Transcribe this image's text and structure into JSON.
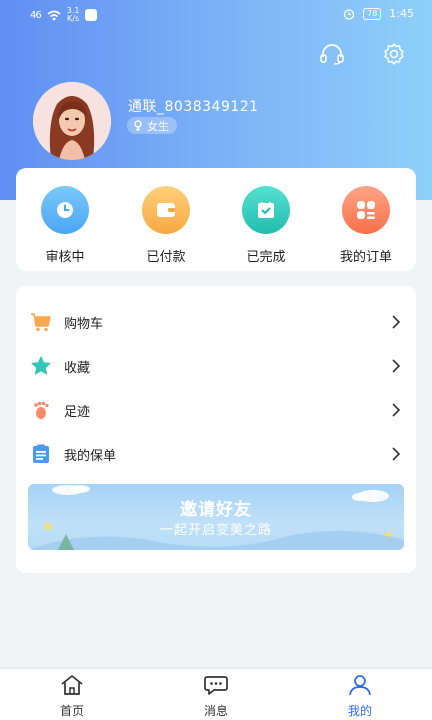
{
  "status_bar": {
    "signal": "46",
    "speed_top": "3.1",
    "speed_bottom": "K/s",
    "battery": "78",
    "time": "1:45"
  },
  "header": {
    "icons": [
      "headset-icon",
      "gear-icon"
    ]
  },
  "profile": {
    "username": "通联_8038349121",
    "gender": "女生"
  },
  "orders": [
    {
      "label": "审核中",
      "icon": "clock-icon",
      "color": "#56b3f5"
    },
    {
      "label": "已付款",
      "icon": "wallet-icon",
      "color": "#f8b552"
    },
    {
      "label": "已完成",
      "icon": "check-bag-icon",
      "color": "#33cbbd"
    },
    {
      "label": "我的订单",
      "icon": "orders-grid-icon",
      "color": "#fa8560"
    }
  ],
  "menu": [
    {
      "label": "购物车",
      "icon": "cart-icon",
      "color": "#f6a94f"
    },
    {
      "label": "收藏",
      "icon": "star-icon",
      "color": "#31c6b8"
    },
    {
      "label": "足迹",
      "icon": "footprint-icon",
      "color": "#f98969"
    },
    {
      "label": "我的保单",
      "icon": "policy-icon",
      "color": "#4a9cf2"
    }
  ],
  "banner": {
    "title": "邀请好友",
    "subtitle": "一起开启变美之路"
  },
  "tabbar": {
    "tabs": [
      {
        "label": "首页",
        "icon": "home-icon"
      },
      {
        "label": "消息",
        "icon": "message-icon"
      },
      {
        "label": "我的",
        "icon": "user-icon"
      }
    ],
    "active_color": "#2e6bf0"
  }
}
